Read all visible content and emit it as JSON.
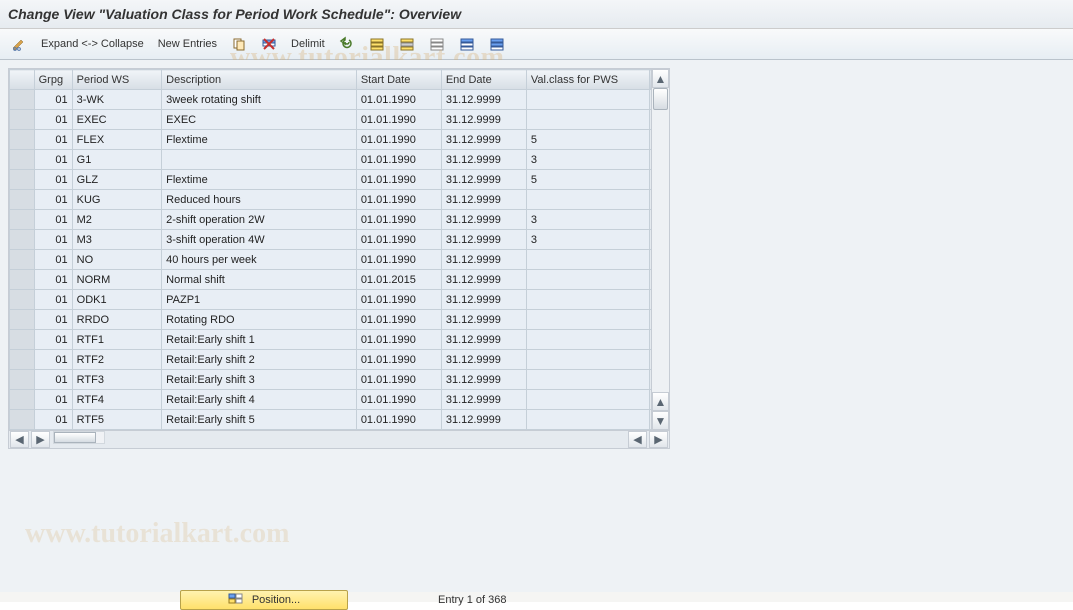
{
  "title": "Change View \"Valuation Class for Period Work Schedule\": Overview",
  "watermark": "www.tutorialkart.com",
  "toolbar": {
    "expand_collapse": "Expand <-> Collapse",
    "new_entries": "New Entries",
    "delimit": "Delimit"
  },
  "columns": {
    "grpg": "Grpg",
    "periodws": "Period WS",
    "description": "Description",
    "start": "Start Date",
    "end": "End Date",
    "valclass": "Val.class for PWS"
  },
  "rows": [
    {
      "grpg": "01",
      "pws": "3-WK",
      "desc": "3week rotating shift",
      "sd": "01.01.1990",
      "ed": "31.12.9999",
      "val": ""
    },
    {
      "grpg": "01",
      "pws": "EXEC",
      "desc": "EXEC",
      "sd": "01.01.1990",
      "ed": "31.12.9999",
      "val": ""
    },
    {
      "grpg": "01",
      "pws": "FLEX",
      "desc": "Flextime",
      "sd": "01.01.1990",
      "ed": "31.12.9999",
      "val": "5"
    },
    {
      "grpg": "01",
      "pws": "G1",
      "desc": "",
      "sd": "01.01.1990",
      "ed": "31.12.9999",
      "val": "3"
    },
    {
      "grpg": "01",
      "pws": "GLZ",
      "desc": "Flextime",
      "sd": "01.01.1990",
      "ed": "31.12.9999",
      "val": "5"
    },
    {
      "grpg": "01",
      "pws": "KUG",
      "desc": "Reduced hours",
      "sd": "01.01.1990",
      "ed": "31.12.9999",
      "val": ""
    },
    {
      "grpg": "01",
      "pws": "M2",
      "desc": "2-shift operation 2W",
      "sd": "01.01.1990",
      "ed": "31.12.9999",
      "val": "3"
    },
    {
      "grpg": "01",
      "pws": "M3",
      "desc": "3-shift operation 4W",
      "sd": "01.01.1990",
      "ed": "31.12.9999",
      "val": "3"
    },
    {
      "grpg": "01",
      "pws": "NO",
      "desc": "40 hours per week",
      "sd": "01.01.1990",
      "ed": "31.12.9999",
      "val": ""
    },
    {
      "grpg": "01",
      "pws": "NORM",
      "desc": "Normal shift",
      "sd": "01.01.2015",
      "ed": "31.12.9999",
      "val": ""
    },
    {
      "grpg": "01",
      "pws": "ODK1",
      "desc": "PAZP1",
      "sd": "01.01.1990",
      "ed": "31.12.9999",
      "val": ""
    },
    {
      "grpg": "01",
      "pws": "RRDO",
      "desc": "Rotating RDO",
      "sd": "01.01.1990",
      "ed": "31.12.9999",
      "val": ""
    },
    {
      "grpg": "01",
      "pws": "RTF1",
      "desc": "Retail:Early shift 1",
      "sd": "01.01.1990",
      "ed": "31.12.9999",
      "val": ""
    },
    {
      "grpg": "01",
      "pws": "RTF2",
      "desc": "Retail:Early shift 2",
      "sd": "01.01.1990",
      "ed": "31.12.9999",
      "val": ""
    },
    {
      "grpg": "01",
      "pws": "RTF3",
      "desc": "Retail:Early shift 3",
      "sd": "01.01.1990",
      "ed": "31.12.9999",
      "val": ""
    },
    {
      "grpg": "01",
      "pws": "RTF4",
      "desc": "Retail:Early shift 4",
      "sd": "01.01.1990",
      "ed": "31.12.9999",
      "val": ""
    },
    {
      "grpg": "01",
      "pws": "RTF5",
      "desc": "Retail:Early shift 5",
      "sd": "01.01.1990",
      "ed": "31.12.9999",
      "val": ""
    }
  ],
  "footer": {
    "position_label": "Position...",
    "entry_text": "Entry 1 of 368"
  }
}
